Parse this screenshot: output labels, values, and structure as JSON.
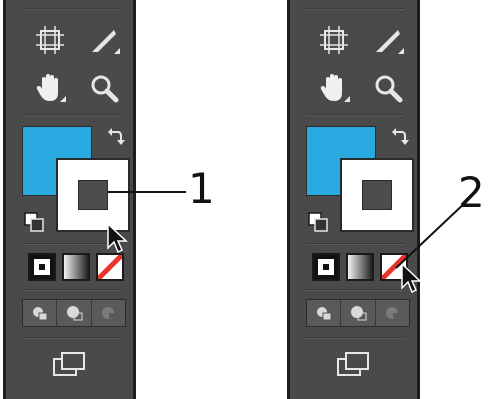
{
  "callouts": {
    "one": "1",
    "two": "2"
  },
  "colors": {
    "panel_bg": "#4a4a4a",
    "fill_color": "#29abe2",
    "stroke_color": "#ffffff",
    "none_red": "#e8322a"
  },
  "panels": [
    {
      "tools": [
        "artboard-icon",
        "knife-icon",
        "hand-icon",
        "zoom-icon"
      ],
      "fill_stroke": {
        "fill": "#29abe2",
        "stroke": "#ffffff"
      },
      "mode_buttons": [
        "color-mode",
        "gradient-mode",
        "none-mode"
      ],
      "draw_modes": [
        "draw-normal",
        "draw-behind",
        "draw-inside"
      ],
      "screen_mode": "change-screen-mode-icon",
      "cursor_target": "stroke-swatch"
    },
    {
      "tools": [
        "artboard-icon",
        "knife-icon",
        "hand-icon",
        "zoom-icon"
      ],
      "fill_stroke": {
        "fill": "#29abe2",
        "stroke": "#ffffff"
      },
      "mode_buttons": [
        "color-mode",
        "gradient-mode",
        "none-mode"
      ],
      "draw_modes": [
        "draw-normal",
        "draw-behind",
        "draw-inside"
      ],
      "screen_mode": "change-screen-mode-icon",
      "cursor_target": "none-mode-button"
    }
  ]
}
